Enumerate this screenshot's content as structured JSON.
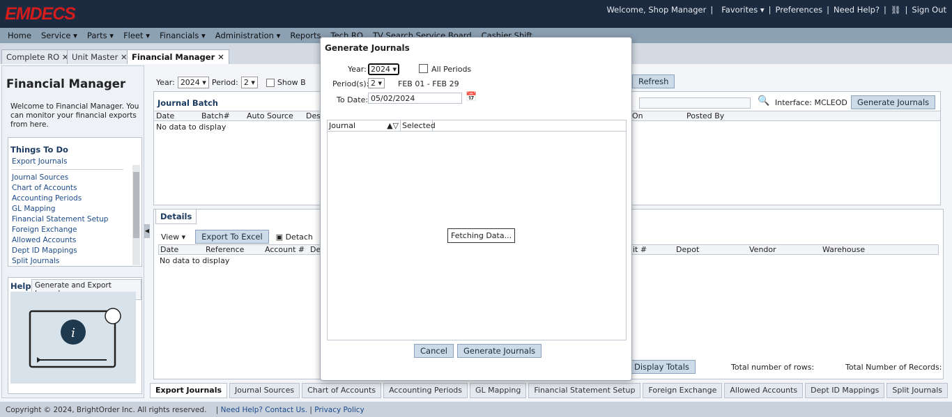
{
  "header": {
    "logo": "EMDECS",
    "welcome": "Welcome, Shop Manager",
    "favorites": "Favorites",
    "preferences": "Preferences",
    "need_help": "Need Help?",
    "sign_out": "Sign Out"
  },
  "nav": [
    "Home",
    "Service",
    "Parts",
    "Fleet",
    "Financials",
    "Administration",
    "Reports",
    "Tech RO",
    "TV Search Service Board",
    "Cashier Shift"
  ],
  "page_tabs": [
    "Complete RO",
    "Unit Master",
    "Financial Manager"
  ],
  "left": {
    "title": "Financial Manager",
    "welcome": "Welcome to Financial Manager. You can monitor your financial exports from here.",
    "todo_title": "Things To Do",
    "todo_first": "Export Journals",
    "todo_items": [
      "Journal Sources",
      "Chart of Accounts",
      "Accounting Periods",
      "GL Mapping",
      "Financial Statement Setup",
      "Foreign Exchange",
      "Allowed Accounts",
      "Dept ID Mappings",
      "Split Journals"
    ],
    "help_title": "Help",
    "help_tab": "Generate and Export Journals"
  },
  "toolbar": {
    "year_label": "Year:",
    "year_value": "2024",
    "period_label": "Period:",
    "period_value": "2",
    "show_label": "Show B",
    "refresh": "Refresh",
    "interface_label": "Interface:",
    "interface_value": "MCLEOD",
    "generate": "Generate Journals"
  },
  "journal_batch": {
    "title": "Journal Batch",
    "columns": [
      "Date",
      "Batch#",
      "Auto Source",
      "Desc"
    ],
    "columns_right": [
      "On",
      "Posted By"
    ],
    "empty": "No data to display"
  },
  "details": {
    "title": "Details",
    "view": "View",
    "export": "Export To Excel",
    "detach": "Detach",
    "columns": [
      "Date",
      "Reference",
      "Account #",
      "Des"
    ],
    "columns_right": [
      "it #",
      "Depot",
      "Vendor",
      "Warehouse"
    ],
    "empty": "No data to display",
    "display_totals": "Display Totals",
    "total_rows": "Total number of rows:",
    "total_records": "Total Number of Records:"
  },
  "bottom_tabs": [
    "Export Journals",
    "Journal Sources",
    "Chart of Accounts",
    "Accounting Periods",
    "GL Mapping",
    "Financial Statement Setup",
    "Foreign Exchange",
    "Allowed Accounts",
    "Dept ID Mappings",
    "Split Journals"
  ],
  "footer": {
    "copyright": "Copyright © 2024, BrightOrder Inc. All rights reserved.",
    "contact": "Need Help? Contact Us.",
    "privacy": "Privacy Policy"
  },
  "modal": {
    "title": "Generate Journals",
    "year_label": "Year:",
    "year_value": "2024",
    "all_periods": "All Periods",
    "periods_label": "Period(s):",
    "period_value": "2",
    "period_range": "FEB 01 - FEB 29",
    "to_date_label": "To Date:",
    "to_date_value": "05/02/2024",
    "col_journal": "Journal",
    "col_selected": "Selected",
    "fetching": "Fetching Data...",
    "cancel": "Cancel",
    "generate": "Generate Journals"
  }
}
